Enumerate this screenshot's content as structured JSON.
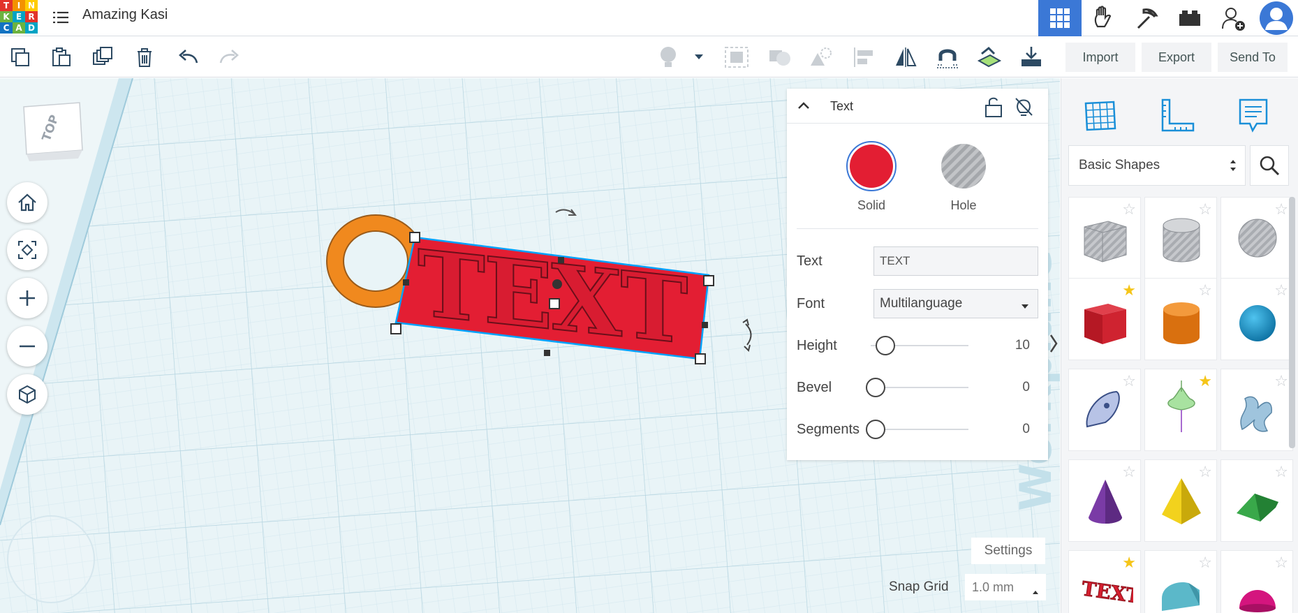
{
  "header": {
    "logo_letters": [
      "T",
      "I",
      "N",
      "K",
      "E",
      "R",
      "C",
      "A",
      "D"
    ],
    "logo_colors": [
      "#e2332a",
      "#f39200",
      "#ffcc00",
      "#6cb33f",
      "#00a3c4",
      "#e2332a",
      "#1273c2",
      "#6cb33f",
      "#00a3c4"
    ],
    "project_title": "Amazing Kasi",
    "view_buttons": [
      "3d-design-grid-icon",
      "circuits-hand-icon",
      "minecraft-pickaxe-icon",
      "bricks-icon",
      "add-user-icon",
      "profile-avatar-icon"
    ]
  },
  "toolbar": {
    "left_icons": [
      "copy-icon",
      "paste-icon",
      "duplicate-icon",
      "delete-icon",
      "undo-icon",
      "redo-icon"
    ],
    "right_icons": [
      "show-lightbulb-icon",
      "dropdown-arrow-icon",
      "group-icon",
      "ungroup-icon",
      "solid-hole-icon",
      "align-icon",
      "mirror-icon",
      "cruise-magnet-icon",
      "workplane-tool-icon",
      "import-drop-icon"
    ],
    "import_label": "Import",
    "export_label": "Export",
    "send_to_label": "Send To"
  },
  "workplane": {
    "viewcube_label": "TOP",
    "nav_buttons": [
      "home-icon",
      "fit-view-icon",
      "zoom-in-icon",
      "zoom-out-icon",
      "perspective-icon"
    ],
    "object_text": "TEXT",
    "watermark": "Workplane",
    "settings_label": "Settings",
    "snap_grid_label": "Snap Grid",
    "snap_grid_value": "1.0 mm"
  },
  "inspector": {
    "title": "Text",
    "solid_label": "Solid",
    "hole_label": "Hole",
    "solid_color": "#e31e33",
    "text_label": "Text",
    "text_value": "TEXT",
    "font_label": "Font",
    "font_value": "Multilanguage",
    "height_label": "Height",
    "height_value": "10",
    "bevel_label": "Bevel",
    "bevel_value": "0",
    "segments_label": "Segments",
    "segments_value": "0"
  },
  "shapes_panel": {
    "tabs": [
      "workplane-grid-icon",
      "ruler-icon",
      "notes-icon"
    ],
    "category": "Basic Shapes",
    "shapes": [
      {
        "name": "box-hole",
        "favorite": false
      },
      {
        "name": "cylinder-hole",
        "favorite": false
      },
      {
        "name": "sphere-hole",
        "favorite": false
      },
      {
        "name": "box",
        "favorite": true
      },
      {
        "name": "cylinder",
        "favorite": false
      },
      {
        "name": "sphere",
        "favorite": false
      },
      {
        "name": "scribble",
        "favorite": false
      },
      {
        "name": "paraboloid-top",
        "favorite": true
      },
      {
        "name": "shape-generator",
        "favorite": false
      },
      {
        "name": "cone",
        "favorite": false
      },
      {
        "name": "pyramid",
        "favorite": false
      },
      {
        "name": "roof",
        "favorite": false
      },
      {
        "name": "text",
        "favorite": true
      },
      {
        "name": "half-cylinder",
        "favorite": false
      },
      {
        "name": "half-sphere",
        "favorite": false
      }
    ]
  },
  "colors": {
    "accent": "#3b78d6",
    "selection": "#00a2ff",
    "text_shape": "#e31e33",
    "ring": "#f0891e"
  }
}
